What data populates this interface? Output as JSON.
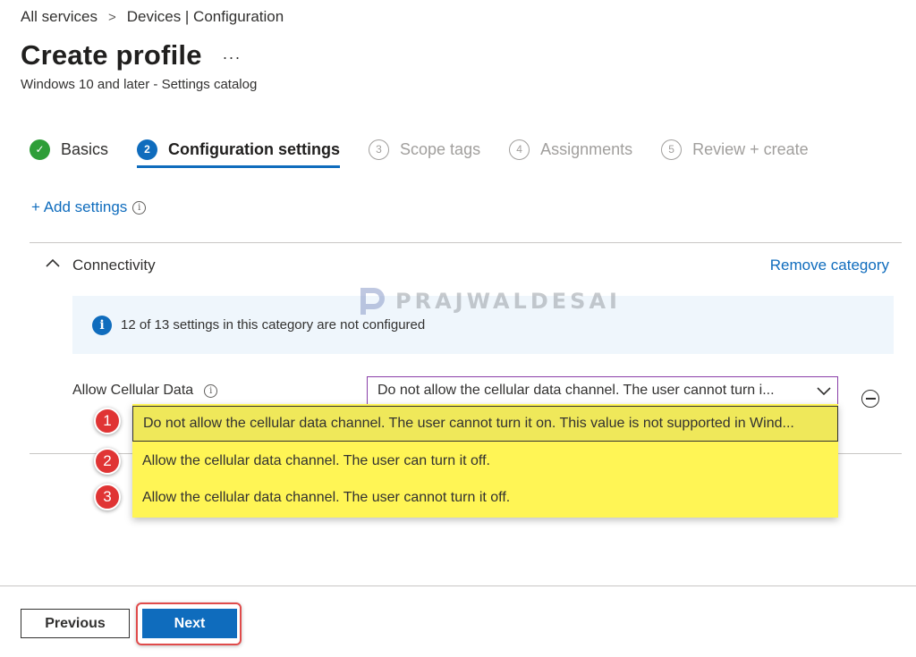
{
  "breadcrumb": {
    "home": "All services",
    "separator": ">",
    "current": "Devices | Configuration"
  },
  "header": {
    "title": "Create profile",
    "more": "...",
    "subtitle": "Windows 10 and later - Settings catalog"
  },
  "steps": [
    {
      "number": "✓",
      "label": "Basics",
      "state": "done"
    },
    {
      "number": "2",
      "label": "Configuration settings",
      "state": "active"
    },
    {
      "number": "3",
      "label": "Scope tags",
      "state": "todo"
    },
    {
      "number": "4",
      "label": "Assignments",
      "state": "todo"
    },
    {
      "number": "5",
      "label": "Review + create",
      "state": "todo"
    }
  ],
  "add_settings": {
    "label": "+ Add settings",
    "info_icon": "i"
  },
  "category": {
    "title": "Connectivity",
    "remove_label": "Remove category",
    "notice_icon": "i",
    "notice_text": "12 of 13 settings in this category are not configured"
  },
  "setting": {
    "label": "Allow Cellular Data",
    "info_icon": "i",
    "selected_value": "Do not allow the cellular data channel. The user cannot turn i...",
    "options": [
      "Do not allow the cellular data channel. The user cannot turn it on. This value is not supported in Wind...",
      "Allow the cellular data channel. The user can turn it off.",
      "Allow the cellular data channel. The user cannot turn it off."
    ],
    "markers": [
      "1",
      "2",
      "3"
    ]
  },
  "watermark": {
    "text": "PRAJWALDESAI"
  },
  "footer": {
    "previous_label": "Previous",
    "next_label": "Next"
  },
  "colors": {
    "accent": "#0f6cbd",
    "success": "#2e9e38",
    "highlight": "#fff555",
    "marker": "#e03434",
    "dropdown_border": "#8a3fa8"
  }
}
